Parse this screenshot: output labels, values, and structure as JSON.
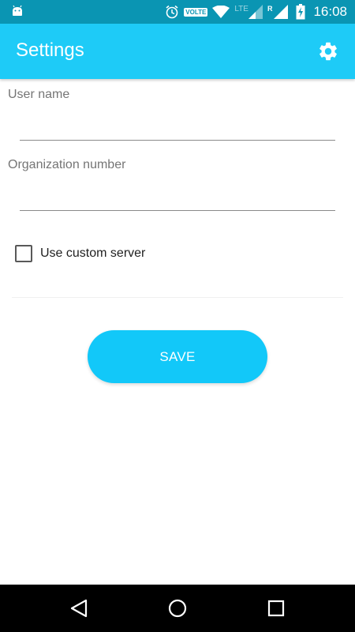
{
  "status_bar": {
    "android_icon": "android-robot-icon",
    "volte_label": "VOLTE",
    "network_label": "LTE",
    "roaming_label": "R",
    "time": "16:08",
    "bg_color": "#0a95b3"
  },
  "app_bar": {
    "title": "Settings",
    "settings_icon": "gear-icon",
    "bg_color": "#1ecbf7"
  },
  "form": {
    "user_name_label": "User name",
    "user_name_value": "",
    "org_number_label": "Organization number",
    "org_number_value": "",
    "custom_server_label": "Use custom server",
    "custom_server_checked": false
  },
  "save_label": "SAVE",
  "accent_color": "#12c8f9",
  "nav_bar": {
    "back_icon": "back-triangle-icon",
    "home_icon": "home-circle-icon",
    "recents_icon": "recents-square-icon"
  }
}
